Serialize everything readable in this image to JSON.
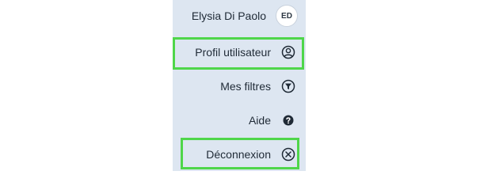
{
  "user": {
    "name": "Elysia Di Paolo",
    "initials": "ED"
  },
  "menu": {
    "items": [
      {
        "label": "Profil utilisateur",
        "icon": "user-circle-icon"
      },
      {
        "label": "Mes filtres",
        "icon": "filter-icon"
      },
      {
        "label": "Aide",
        "icon": "help-icon"
      },
      {
        "label": "Déconnexion",
        "icon": "close-circle-icon"
      }
    ]
  },
  "colors": {
    "menu_background": "#dde6f1",
    "highlight": "#4fd64a",
    "text": "#1f2a36"
  }
}
